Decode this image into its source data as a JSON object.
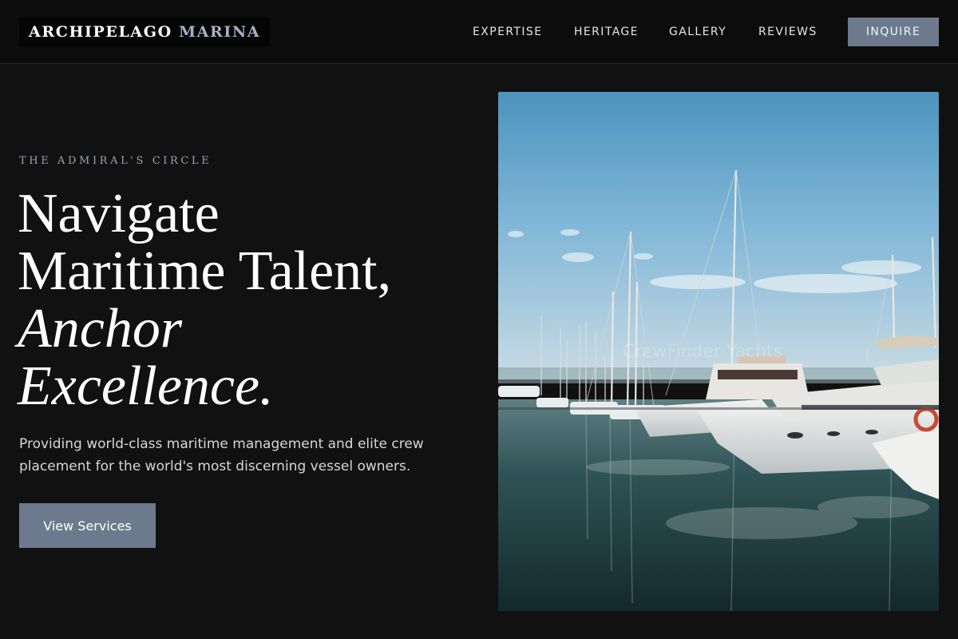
{
  "brand": {
    "name_part1": "ARCHIPELAGO",
    "name_part2": "MARINA",
    "accent_color": "#a7b0c8"
  },
  "nav": {
    "items": [
      {
        "label": "EXPERTISE"
      },
      {
        "label": "HERITAGE"
      },
      {
        "label": "GALLERY"
      },
      {
        "label": "REVIEWS"
      }
    ],
    "cta_label": "INQUIRE"
  },
  "hero": {
    "eyebrow": "THE ADMIRAL'S CIRCLE",
    "headline_line1": "Navigate",
    "headline_line2": "Maritime Talent,",
    "headline_line3": "Anchor",
    "headline_line4": "Excellence.",
    "subtext": "Providing world-class maritime management and elite crew placement for the world's most discerning vessel owners.",
    "cta_label": "View Services",
    "image": {
      "subject": "marina-with-yachts-photo",
      "watermark": "CrewFinder Yachts"
    }
  },
  "colors": {
    "background": "#111111",
    "header_background": "#0c0c0c",
    "button": "#6d7a8e",
    "text": "#ffffff",
    "muted_text": "#d7d7d7"
  }
}
